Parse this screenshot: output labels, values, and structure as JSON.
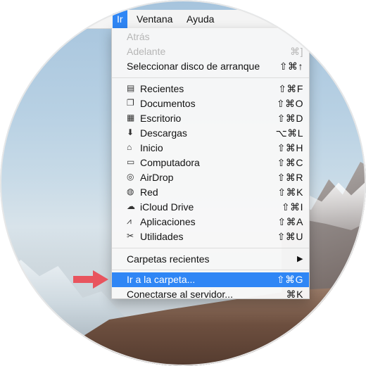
{
  "menubar": {
    "items": [
      "Ir",
      "Ventana",
      "Ayuda"
    ]
  },
  "menu": {
    "top_items": [
      {
        "label": "Atrás",
        "shortcut": "",
        "disabled": true
      },
      {
        "label": "Adelante",
        "shortcut": "⌘]",
        "disabled": true
      },
      {
        "label": "Seleccionar disco de arranque",
        "shortcut": "⇧⌘↑",
        "disabled": false
      }
    ],
    "places": [
      {
        "label": "Recientes",
        "icon": "recents-icon",
        "shortcut": "⇧⌘F"
      },
      {
        "label": "Documentos",
        "icon": "documents-icon",
        "shortcut": "⇧⌘O"
      },
      {
        "label": "Escritorio",
        "icon": "desktop-icon",
        "shortcut": "⇧⌘D"
      },
      {
        "label": "Descargas",
        "icon": "downloads-icon",
        "shortcut": "⌥⌘L"
      },
      {
        "label": "Inicio",
        "icon": "home-icon",
        "shortcut": "⇧⌘H"
      },
      {
        "label": "Computadora",
        "icon": "computer-icon",
        "shortcut": "⇧⌘C"
      },
      {
        "label": "AirDrop",
        "icon": "airdrop-icon",
        "shortcut": "⇧⌘R"
      },
      {
        "label": "Red",
        "icon": "network-icon",
        "shortcut": "⇧⌘K"
      },
      {
        "label": "iCloud Drive",
        "icon": "icloud-icon",
        "shortcut": "⇧⌘I"
      },
      {
        "label": "Aplicaciones",
        "icon": "applications-icon",
        "shortcut": "⇧⌘A"
      },
      {
        "label": "Utilidades",
        "icon": "utilities-icon",
        "shortcut": "⇧⌘U"
      }
    ],
    "recent_folders": {
      "label": "Carpetas recientes",
      "submenu_icon": "submenu-arrow-icon"
    },
    "bottom_items": [
      {
        "label": "Ir a la carpeta...",
        "shortcut": "⇧⌘G",
        "selected": true
      },
      {
        "label": "Conectarse al servidor...",
        "shortcut": "⌘K",
        "selected": false
      }
    ]
  },
  "colors": {
    "selection": "#2f86f5",
    "arrow": "#e8545e"
  }
}
